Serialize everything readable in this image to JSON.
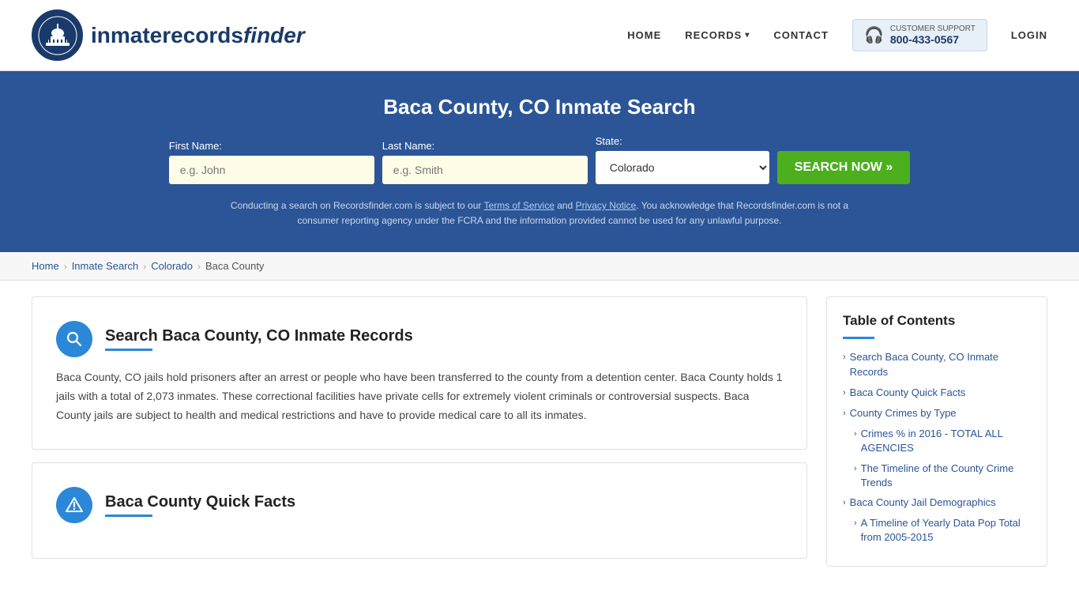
{
  "header": {
    "logo_text_main": "inmaterecords",
    "logo_text_bold": "finder",
    "nav": {
      "home": "HOME",
      "records": "RECORDS",
      "contact": "CONTACT",
      "login": "LOGIN",
      "support_label": "CUSTOMER SUPPORT",
      "support_number": "800-433-0567"
    }
  },
  "hero": {
    "title": "Baca County, CO Inmate Search",
    "form": {
      "first_name_label": "First Name:",
      "first_name_placeholder": "e.g. John",
      "last_name_label": "Last Name:",
      "last_name_placeholder": "e.g. Smith",
      "state_label": "State:",
      "state_value": "Colorado",
      "search_button": "SEARCH NOW »"
    },
    "disclaimer": "Conducting a search on Recordsfinder.com is subject to our Terms of Service and Privacy Notice. You acknowledge that Recordsfinder.com is not a consumer reporting agency under the FCRA and the information provided cannot be used for any unlawful purpose."
  },
  "breadcrumb": {
    "home": "Home",
    "inmate_search": "Inmate Search",
    "state": "Colorado",
    "county": "Baca County"
  },
  "main_section": {
    "title": "Search Baca County, CO Inmate Records",
    "body": "Baca County, CO jails hold prisoners after an arrest or people who have been transferred to the county from a detention center. Baca County holds 1 jails with a total of 2,073 inmates. These correctional facilities have private cells for extremely violent criminals or controversial suspects. Baca County jails are subject to health and medical restrictions and have to provide medical care to all its inmates."
  },
  "quick_facts_section": {
    "title": "Baca County Quick Facts"
  },
  "toc": {
    "title": "Table of Contents",
    "items": [
      {
        "label": "Search Baca County, CO Inmate Records",
        "sub": false
      },
      {
        "label": "Baca County Quick Facts",
        "sub": false
      },
      {
        "label": "County Crimes by Type",
        "sub": false
      },
      {
        "label": "Crimes % in 2016 - TOTAL ALL AGENCIES",
        "sub": true
      },
      {
        "label": "The Timeline of the County Crime Trends",
        "sub": true
      },
      {
        "label": "Baca County Jail Demographics",
        "sub": false
      },
      {
        "label": "A Timeline of Yearly Data Pop Total from 2005-2015",
        "sub": true
      }
    ]
  }
}
